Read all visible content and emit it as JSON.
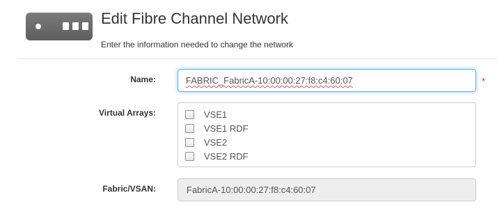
{
  "header": {
    "icon": "fibre-channel-switch-icon",
    "title": "Edit Fibre Channel Network",
    "subtitle": "Enter the information needed to change the network"
  },
  "form": {
    "name": {
      "label": "Name:",
      "value": "FABRIC_FabricA-10:00:00:27:f8:c4:60:07",
      "required_marker": "*"
    },
    "virtual_arrays": {
      "label": "Virtual Arrays:",
      "items": [
        {
          "label": "VSE1",
          "checked": false
        },
        {
          "label": "VSE1 RDF",
          "checked": false
        },
        {
          "label": "VSE2",
          "checked": false
        },
        {
          "label": "VSE2 RDF",
          "checked": false
        }
      ]
    },
    "fabric_vsan": {
      "label": "Fabric/VSAN:",
      "value": "FabricA-10:00:00:27:f8:c4:60:07"
    }
  },
  "colors": {
    "focus_border": "#66afe9",
    "required": "#c9302c",
    "readonly_bg": "#eeeeee",
    "icon_bg": "#6b6b6b"
  }
}
